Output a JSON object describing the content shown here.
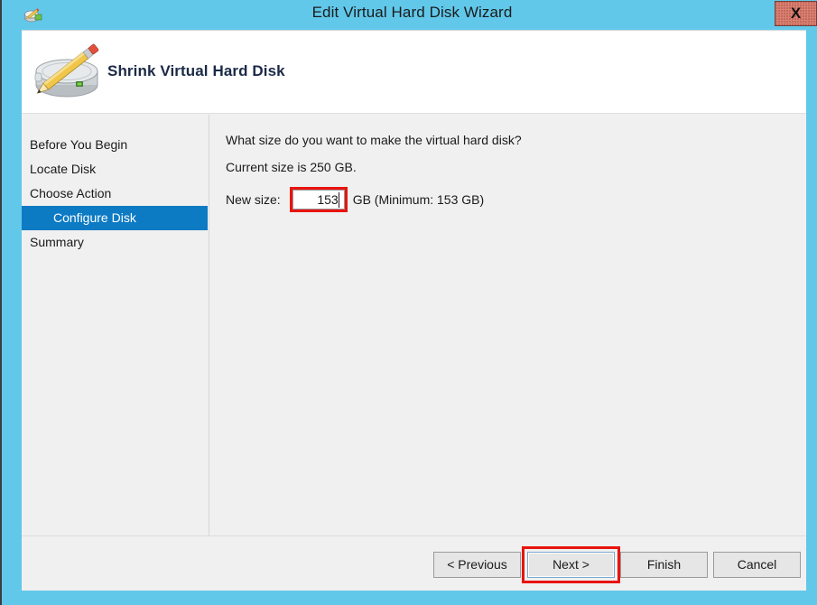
{
  "window": {
    "title": "Edit Virtual Hard Disk Wizard",
    "title_icon": "edit-virtual-hard-disk-icon",
    "close_label": "X",
    "frame_color": "#61c8ea"
  },
  "header": {
    "title": "Shrink Virtual Hard Disk",
    "icon": "hard-disk-with-pencil-icon"
  },
  "sidebar": {
    "items": [
      {
        "label": "Before You Begin",
        "selected": false
      },
      {
        "label": "Locate Disk",
        "selected": false
      },
      {
        "label": "Choose Action",
        "selected": false
      },
      {
        "label": "Configure Disk",
        "selected": true
      },
      {
        "label": "Summary",
        "selected": false
      }
    ],
    "selected_color": "#0d7ac4"
  },
  "main": {
    "question": "What size do you want to make the virtual hard disk?",
    "current_size_text": "Current size is 250 GB.",
    "new_size_label": "New size:",
    "new_size_value": "153",
    "new_size_placeholder": "",
    "new_size_suffix": "GB (Minimum: 153 GB)"
  },
  "footer": {
    "buttons": [
      {
        "label": "< Previous",
        "name": "previous-button",
        "highlighted": false
      },
      {
        "label": "Next >",
        "name": "next-button",
        "highlighted": true
      },
      {
        "label": "Finish",
        "name": "finish-button",
        "highlighted": false
      },
      {
        "label": "Cancel",
        "name": "cancel-button",
        "highlighted": false
      }
    ]
  },
  "annotations": {
    "color": "#e8140f",
    "targets": [
      "new-size-input",
      "next-button"
    ]
  }
}
